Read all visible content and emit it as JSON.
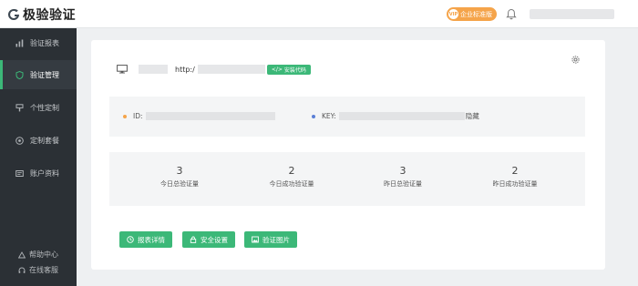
{
  "app": {
    "title": "极验验证"
  },
  "header": {
    "badge_vip": "VIP",
    "badge_label": "企业标准版",
    "bell_icon": "bell-icon"
  },
  "sidebar": {
    "items": [
      {
        "label": "验证报表",
        "icon": "bar-chart-icon",
        "active": false
      },
      {
        "label": "验证管理",
        "icon": "shield-icon",
        "active": true
      },
      {
        "label": "个性定制",
        "icon": "brush-icon",
        "active": false
      },
      {
        "label": "定制套餐",
        "icon": "target-icon",
        "active": false
      },
      {
        "label": "账户资料",
        "icon": "id-card-icon",
        "active": false
      }
    ],
    "help": "帮助中心",
    "service": "在线客服"
  },
  "app_row": {
    "url_prefix": "http:/",
    "install_label": "安装代码"
  },
  "keys": {
    "id_label": "ID:",
    "key_label": "KEY:",
    "hide_label": "隐藏",
    "id_dot_color": "#f5a44a",
    "key_dot_color": "#5b7fd6"
  },
  "stats": [
    {
      "value": "3",
      "label": "今日总验证量"
    },
    {
      "value": "2",
      "label": "今日成功验证量"
    },
    {
      "value": "3",
      "label": "昨日总验证量"
    },
    {
      "value": "2",
      "label": "昨日成功验证量"
    }
  ],
  "actions": [
    {
      "label": "报表详情",
      "icon": "clock-icon"
    },
    {
      "label": "安全设置",
      "icon": "lock-icon"
    },
    {
      "label": "验证图片",
      "icon": "image-icon"
    }
  ],
  "colors": {
    "accent": "#3cb878",
    "sidebar": "#2b3035",
    "badge": "#f5a44a"
  }
}
